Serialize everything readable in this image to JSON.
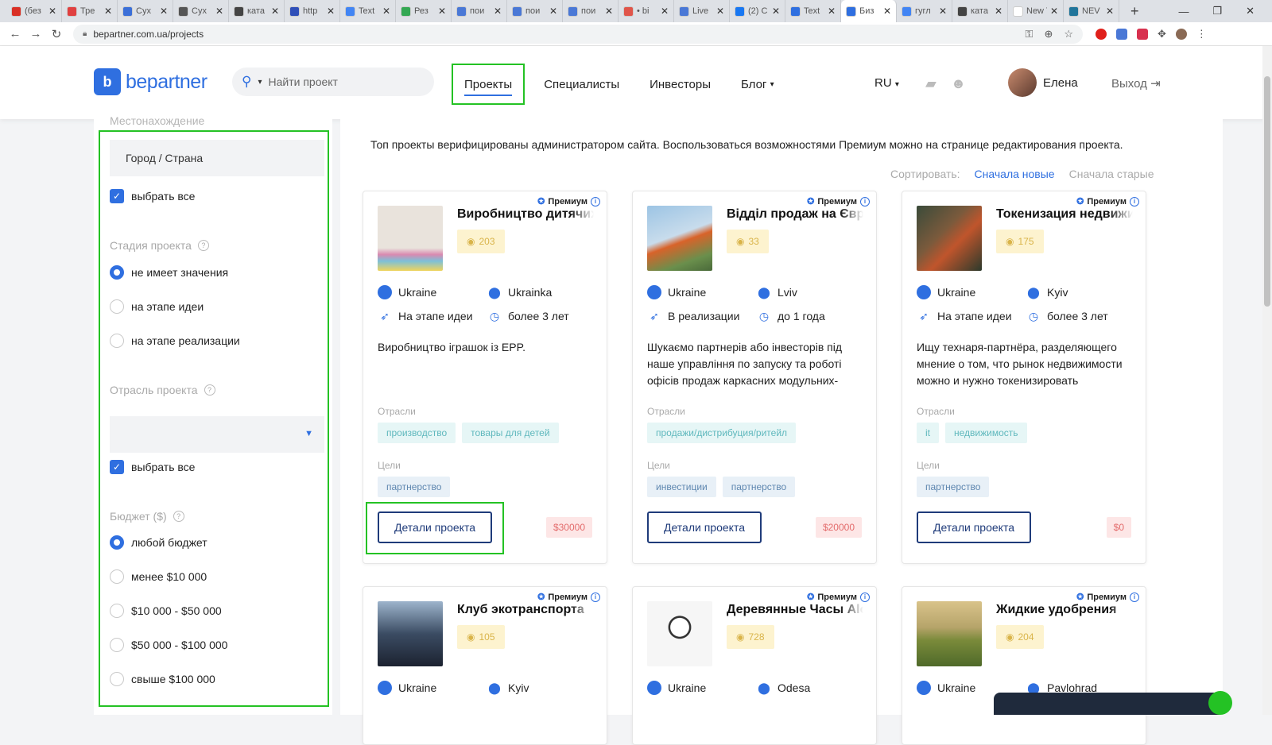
{
  "browser": {
    "tabs": [
      {
        "title": "(без",
        "color": "#d93025"
      },
      {
        "title": "Тре",
        "color": "#e04040"
      },
      {
        "title": "Сух",
        "color": "#3b6fd8"
      },
      {
        "title": "Сух",
        "color": "#555555"
      },
      {
        "title": "ката",
        "color": "#444444"
      },
      {
        "title": "http",
        "color": "#2f4fb8"
      },
      {
        "title": "Text",
        "color": "#4285f4"
      },
      {
        "title": "Рез",
        "color": "#34a853"
      },
      {
        "title": "пои",
        "color": "#4a78d6"
      },
      {
        "title": "пои",
        "color": "#4a78d6"
      },
      {
        "title": "пои",
        "color": "#4a78d6"
      },
      {
        "title": "• bi",
        "color": "#e0554a"
      },
      {
        "title": "Live",
        "color": "#4a78d6"
      },
      {
        "title": "(2) С",
        "color": "#1877f2"
      },
      {
        "title": "Text",
        "color": "#2f6fe0"
      },
      {
        "title": "Биз",
        "color": "#2f6fe0",
        "active": true
      },
      {
        "title": "гугл",
        "color": "#4285f4"
      },
      {
        "title": "ката",
        "color": "#444444"
      },
      {
        "title": "New Tab",
        "color": "#ffffff"
      },
      {
        "title": "NEV",
        "color": "#21759b"
      }
    ],
    "new_tab": "+",
    "url": "bepartner.com.ua/projects",
    "window_controls": [
      "—",
      "❐",
      "✕"
    ]
  },
  "header": {
    "logo_mark": "b",
    "logo_text": "bepartner",
    "search_placeholder": "Найти проект",
    "nav": [
      "Проекты",
      "Специалисты",
      "Инвесторы",
      "Блог"
    ],
    "lang": "RU",
    "user_name": "Елена",
    "logout": "Выход"
  },
  "sidebar": {
    "cut_label": "Местонахождение",
    "city_placeholder": "Город / Страна",
    "select_all": "выбрать все",
    "stage_title": "Стадия проекта",
    "stage_options": [
      "не имеет значения",
      "на этапе идеи",
      "на этапе реализации"
    ],
    "industry_title": "Отрасль проекта",
    "select_all_2": "выбрать все",
    "budget_title": "Бюджет ($)",
    "budget_options": [
      "любой бюджет",
      "менее $10 000",
      "$10 000 - $50 000",
      "$50 000 - $100 000",
      "свыше $100 000"
    ]
  },
  "main": {
    "intro": "Топ проекты верифицированы администратором сайта. Воспользоваться возможностями Премиум можно на странице редактирования проекта.",
    "sort_label": "Сортировать:",
    "sort_new": "Сначала новые",
    "sort_old": "Сначала старые",
    "premium": "Премиум",
    "industries_label": "Отрасли",
    "goals_label": "Цели",
    "details_label": "Детали проекта",
    "cards": [
      {
        "title": "Виробництво дитячих",
        "views": "203",
        "country": "Ukraine",
        "city": "Ukrainka",
        "stage": "На этапе идеи",
        "age": "более 3 лет",
        "description": "Виробництво іграшок із EPP.",
        "industries": [
          "производство",
          "товары для детей"
        ],
        "goals": [
          "партнерство"
        ],
        "price": "$30000",
        "thumb": "kids"
      },
      {
        "title": "Відділ продаж на Євро",
        "views": "33",
        "country": "Ukraine",
        "city": "Lviv",
        "stage": "В реализации",
        "age": "до 1 года",
        "description": "Шукаємо партнерів або інвесторів під наше управління по запуску та роботі офісів продаж каркасних модульних-",
        "industries": [
          "продажи/дистрибуция/ритейл"
        ],
        "goals": [
          "инвестиции",
          "партнерство"
        ],
        "price": "$20000",
        "thumb": "crane"
      },
      {
        "title": "Токенизация недвижимости",
        "views": "175",
        "country": "Ukraine",
        "city": "Kyiv",
        "stage": "На этапе идеи",
        "age": "более 3 лет",
        "description": "Ищу технаря-партнёра, разделяющего мнение о том, что рынок недвижимости можно и нужно токенизировать",
        "industries": [
          "it",
          "недвижимость"
        ],
        "goals": [
          "партнерство"
        ],
        "price": "$0",
        "thumb": "joker"
      },
      {
        "title": "Клуб экотранспорта",
        "views": "105",
        "country": "Ukraine",
        "city": "Kyiv",
        "thumb": "people"
      },
      {
        "title": "Деревянные Часы Alo",
        "views": "728",
        "country": "Ukraine",
        "city": "Odesa",
        "thumb": "clock"
      },
      {
        "title": "Жидкие удобрения",
        "views": "204",
        "country": "Ukraine",
        "city": "Pavlohrad",
        "thumb": "field"
      }
    ]
  },
  "colors": {
    "brand": "#2f6fe0",
    "highlight": "#24c224",
    "price_bg": "#fde6e6",
    "views_bg": "#fdf3cf"
  }
}
